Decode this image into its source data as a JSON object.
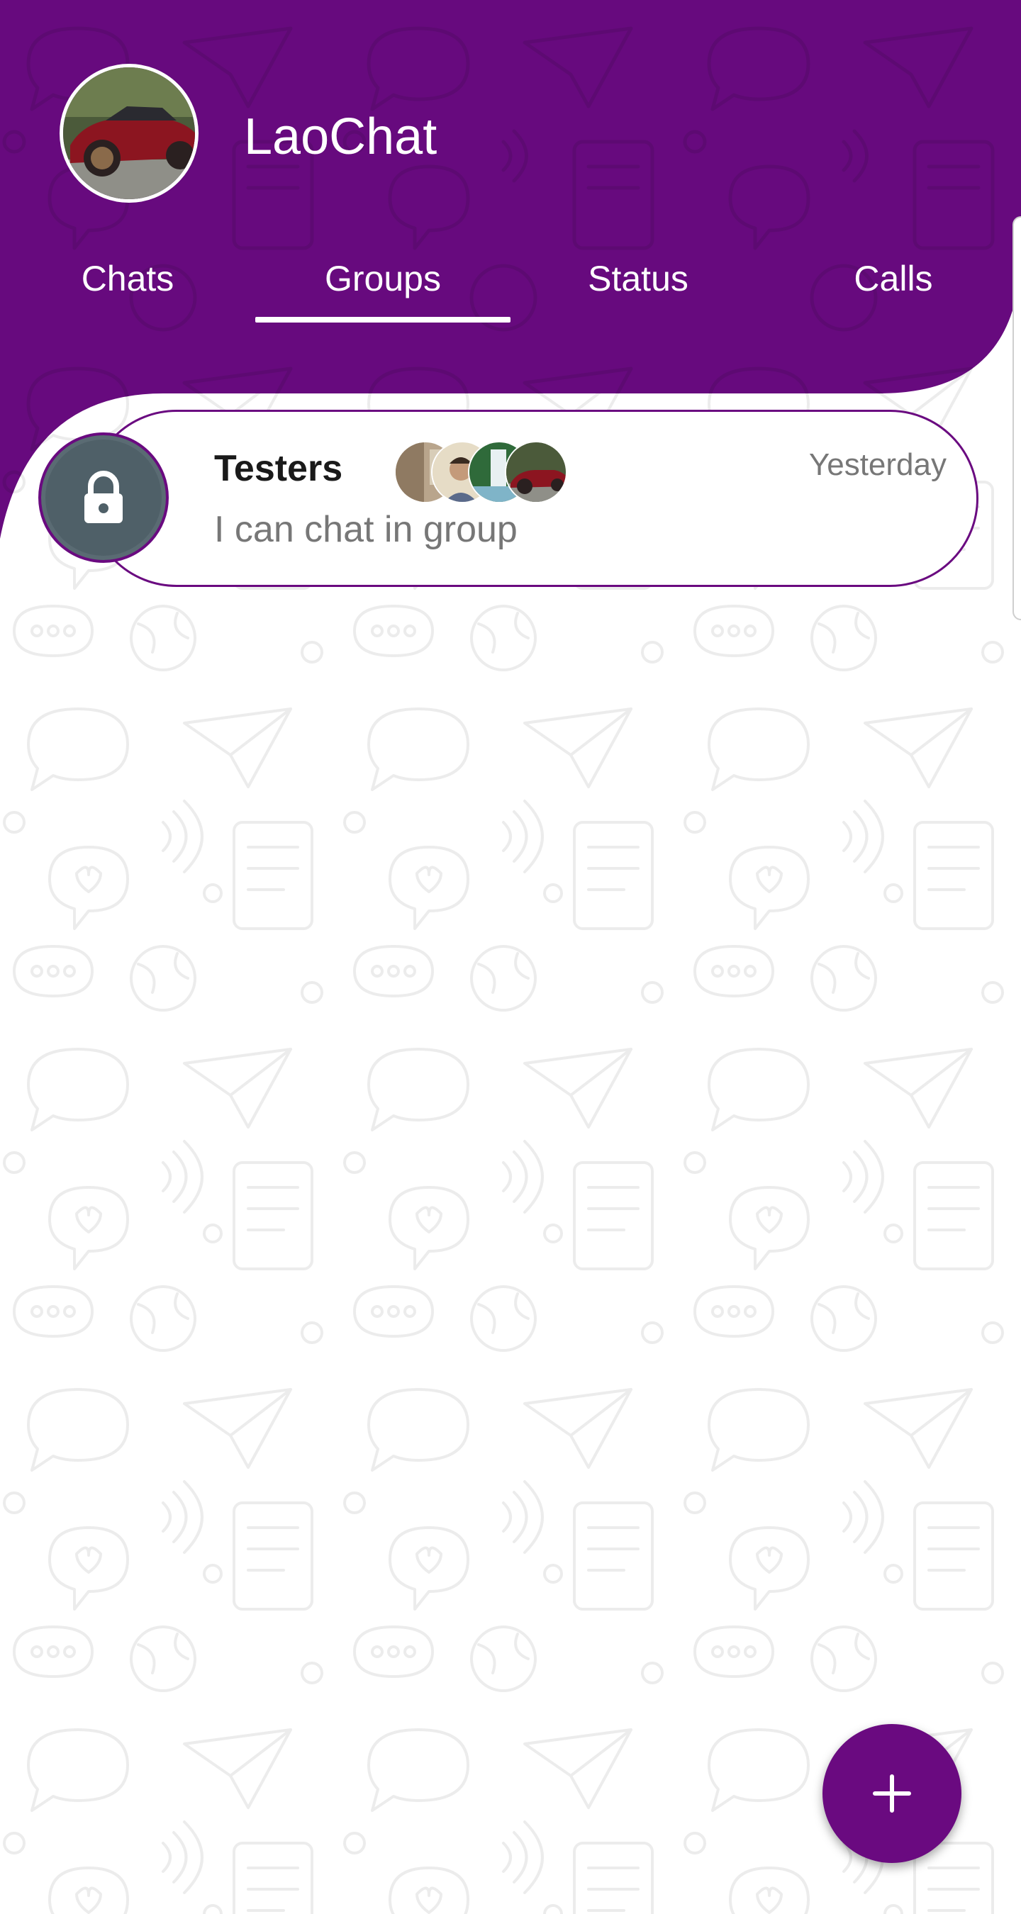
{
  "app": {
    "title": "LaoChat",
    "brand_color": "#6a0a80"
  },
  "profile": {
    "avatar_icon": "user-avatar-car-photo"
  },
  "tabs": [
    {
      "label": "Chats",
      "selected": false
    },
    {
      "label": "Groups",
      "selected": true
    },
    {
      "label": "Status",
      "selected": false
    },
    {
      "label": "Calls",
      "selected": false
    }
  ],
  "groups": [
    {
      "name": "Testers",
      "time": "Yesterday",
      "last_message": "I can chat in group",
      "icon": "lock-icon",
      "member_avatars": [
        "member-photo-room",
        "member-photo-person",
        "member-photo-waterfall",
        "member-photo-car"
      ]
    }
  ],
  "fab": {
    "icon": "plus-icon"
  }
}
